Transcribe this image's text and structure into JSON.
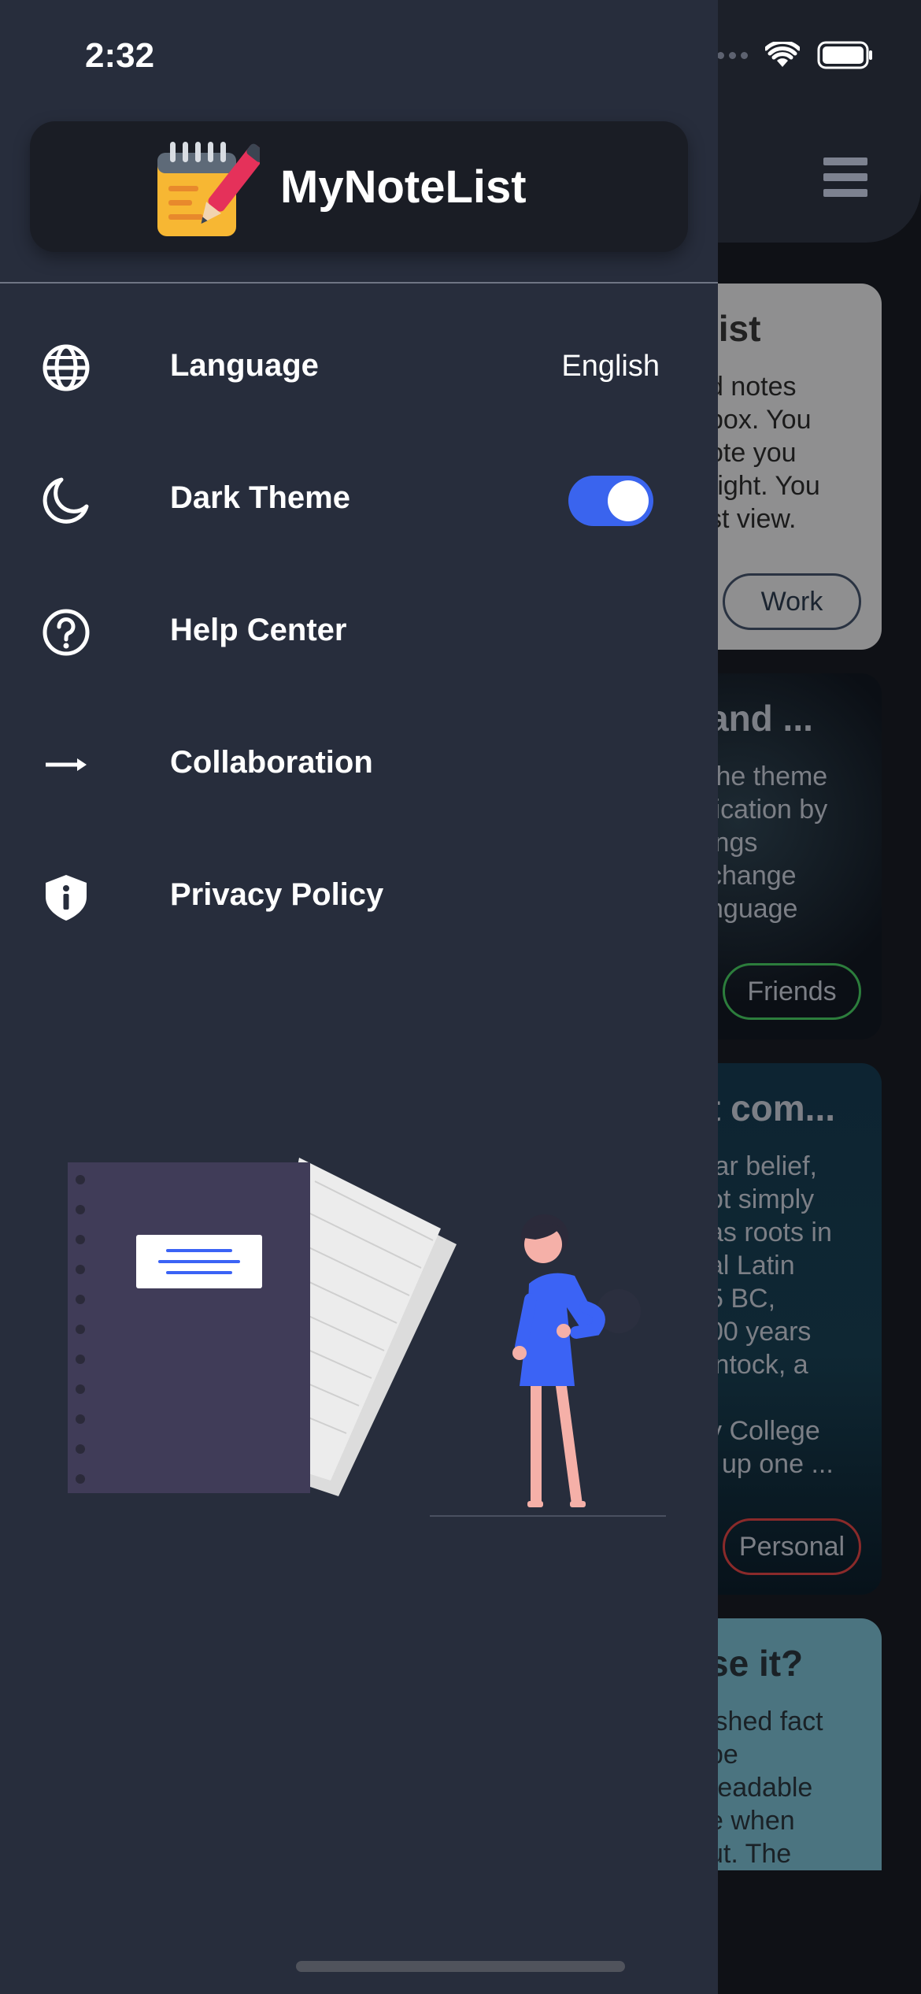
{
  "status_bar": {
    "time": "2:32"
  },
  "brand": {
    "app_name": "MyNoteList",
    "logo_icon": "notepad-pencil-icon"
  },
  "menu": {
    "items": [
      {
        "id": "language",
        "label": "Language",
        "value": "English",
        "icon": "globe-icon"
      },
      {
        "id": "dark-theme",
        "label": "Dark Theme",
        "toggle_on": true,
        "icon": "moon-icon"
      },
      {
        "id": "help-center",
        "label": "Help Center",
        "icon": "question-circle-icon"
      },
      {
        "id": "collaboration",
        "label": "Collaboration",
        "icon": "arrow-right-icon"
      },
      {
        "id": "privacy-policy",
        "label": "Privacy Policy",
        "icon": "shield-info-icon"
      }
    ]
  },
  "background": {
    "cards": [
      {
        "title": "list",
        "body": "d notes\nbox. You\note you\nright. You\nst view.",
        "tag": "Work"
      },
      {
        "title": "and ...",
        "body": "the theme\nlication by\nings\nchange\nnguage",
        "tag": "Friends"
      },
      {
        "title": "t com...",
        "body": "lar belief,\not simply\nas roots in\nal Latin\n5 BC,\n00 years\nintock, a\nt\ny College\nl up one ...",
        "tag": "Personal"
      },
      {
        "title": "se it?",
        "body": "ished fact\nbe\nreadable\ne when\nut. The"
      }
    ]
  },
  "colors": {
    "drawer_bg": "#272d3c",
    "brand_card_bg": "#1a1d25",
    "accent": "#3a64ee",
    "illustration_accent": "#3b63f5"
  }
}
